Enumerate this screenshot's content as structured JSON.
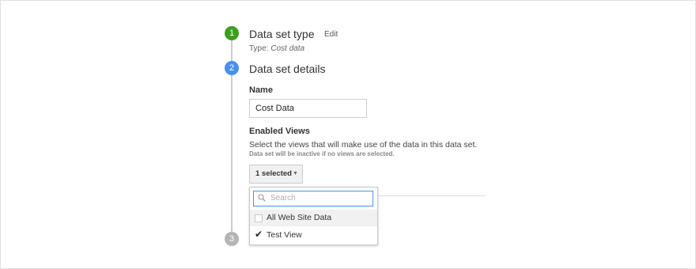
{
  "steps": [
    {
      "number": "1",
      "title": "Data set type",
      "edit_label": "Edit",
      "type_prefix": "Type:",
      "type_value": "Cost data"
    },
    {
      "number": "2",
      "title": "Data set details"
    },
    {
      "number": "3"
    }
  ],
  "details": {
    "name_label": "Name",
    "name_value": "Cost Data",
    "views_label": "Enabled Views",
    "views_desc": "Select the views that will make use of the data in this data set.",
    "views_hint": "Data set will be inactive if no views are selected.",
    "select_label": "1 selected"
  },
  "dropdown": {
    "search_placeholder": "Search",
    "options": [
      {
        "label": "All Web Site Data",
        "checked": false
      },
      {
        "label": "Test View",
        "checked": true
      }
    ]
  },
  "colors": {
    "step_done": "#3e9e1f",
    "step_active": "#4a8ff0",
    "step_pending": "#b5b5b5",
    "focus": "#4a8ff0"
  }
}
